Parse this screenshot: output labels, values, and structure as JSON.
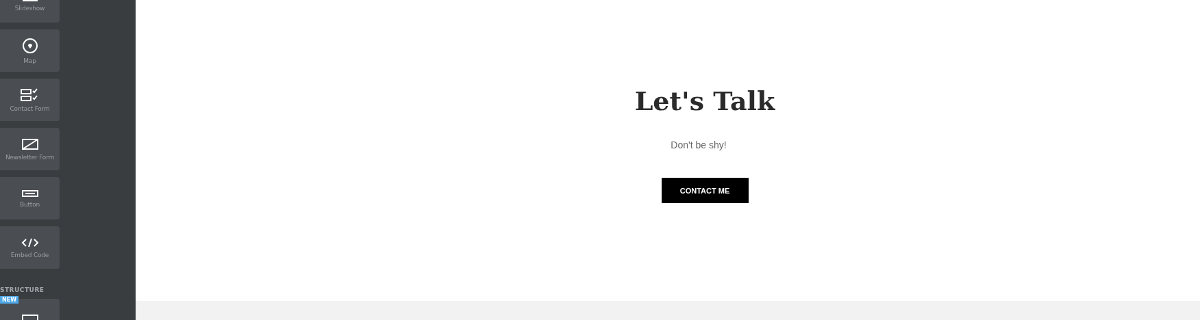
{
  "sidebar": {
    "tiles": [
      {
        "kind": "slideshow",
        "label": "Slideshow"
      },
      {
        "kind": "map",
        "label": "Map"
      },
      {
        "kind": "form",
        "label": "Contact Form"
      },
      {
        "kind": "newsletter",
        "label": "Newsletter Form"
      },
      {
        "kind": "button",
        "label": "Button"
      },
      {
        "kind": "code",
        "label": "Embed Code"
      }
    ],
    "section": {
      "title": "STRUCTURE",
      "tiles": [
        {
          "kind": "box",
          "badge": "NEW"
        }
      ]
    }
  },
  "content": {
    "heading": "Let's Talk",
    "subtitle": "Don't be shy!",
    "button": "CONTACT ME"
  }
}
